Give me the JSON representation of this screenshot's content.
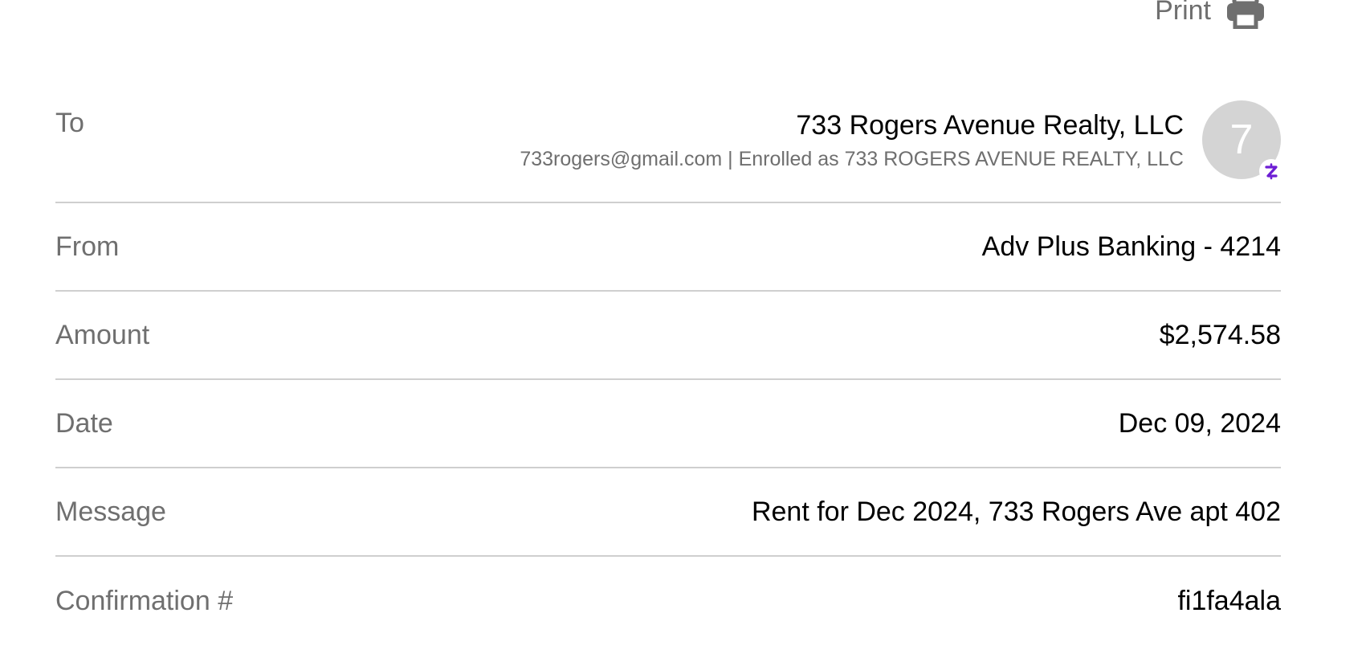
{
  "header": {
    "print_label": "Print",
    "print_icon": "printer-icon"
  },
  "details": {
    "to": {
      "label": "To",
      "name": "733 Rogers Avenue Realty, LLC",
      "subtitle": "733rogers@gmail.com | Enrolled as 733 ROGERS AVENUE REALTY, LLC",
      "avatar_initial": "7",
      "badge_icon": "zelle-icon"
    },
    "from": {
      "label": "From",
      "value": "Adv Plus Banking - 4214"
    },
    "amount": {
      "label": "Amount",
      "value": "$2,574.58"
    },
    "date": {
      "label": "Date",
      "value": "Dec 09, 2024"
    },
    "message": {
      "label": "Message",
      "value": "Rent for Dec 2024, 733 Rogers Ave apt 402"
    },
    "confirmation": {
      "label": "Confirmation #",
      "value": "fi1fa4ala"
    }
  },
  "colors": {
    "label_gray": "#6f6f6f",
    "divider": "#cfcfcf",
    "avatar_bg": "#d4d4d4",
    "zelle_purple": "#6d1ed4"
  }
}
